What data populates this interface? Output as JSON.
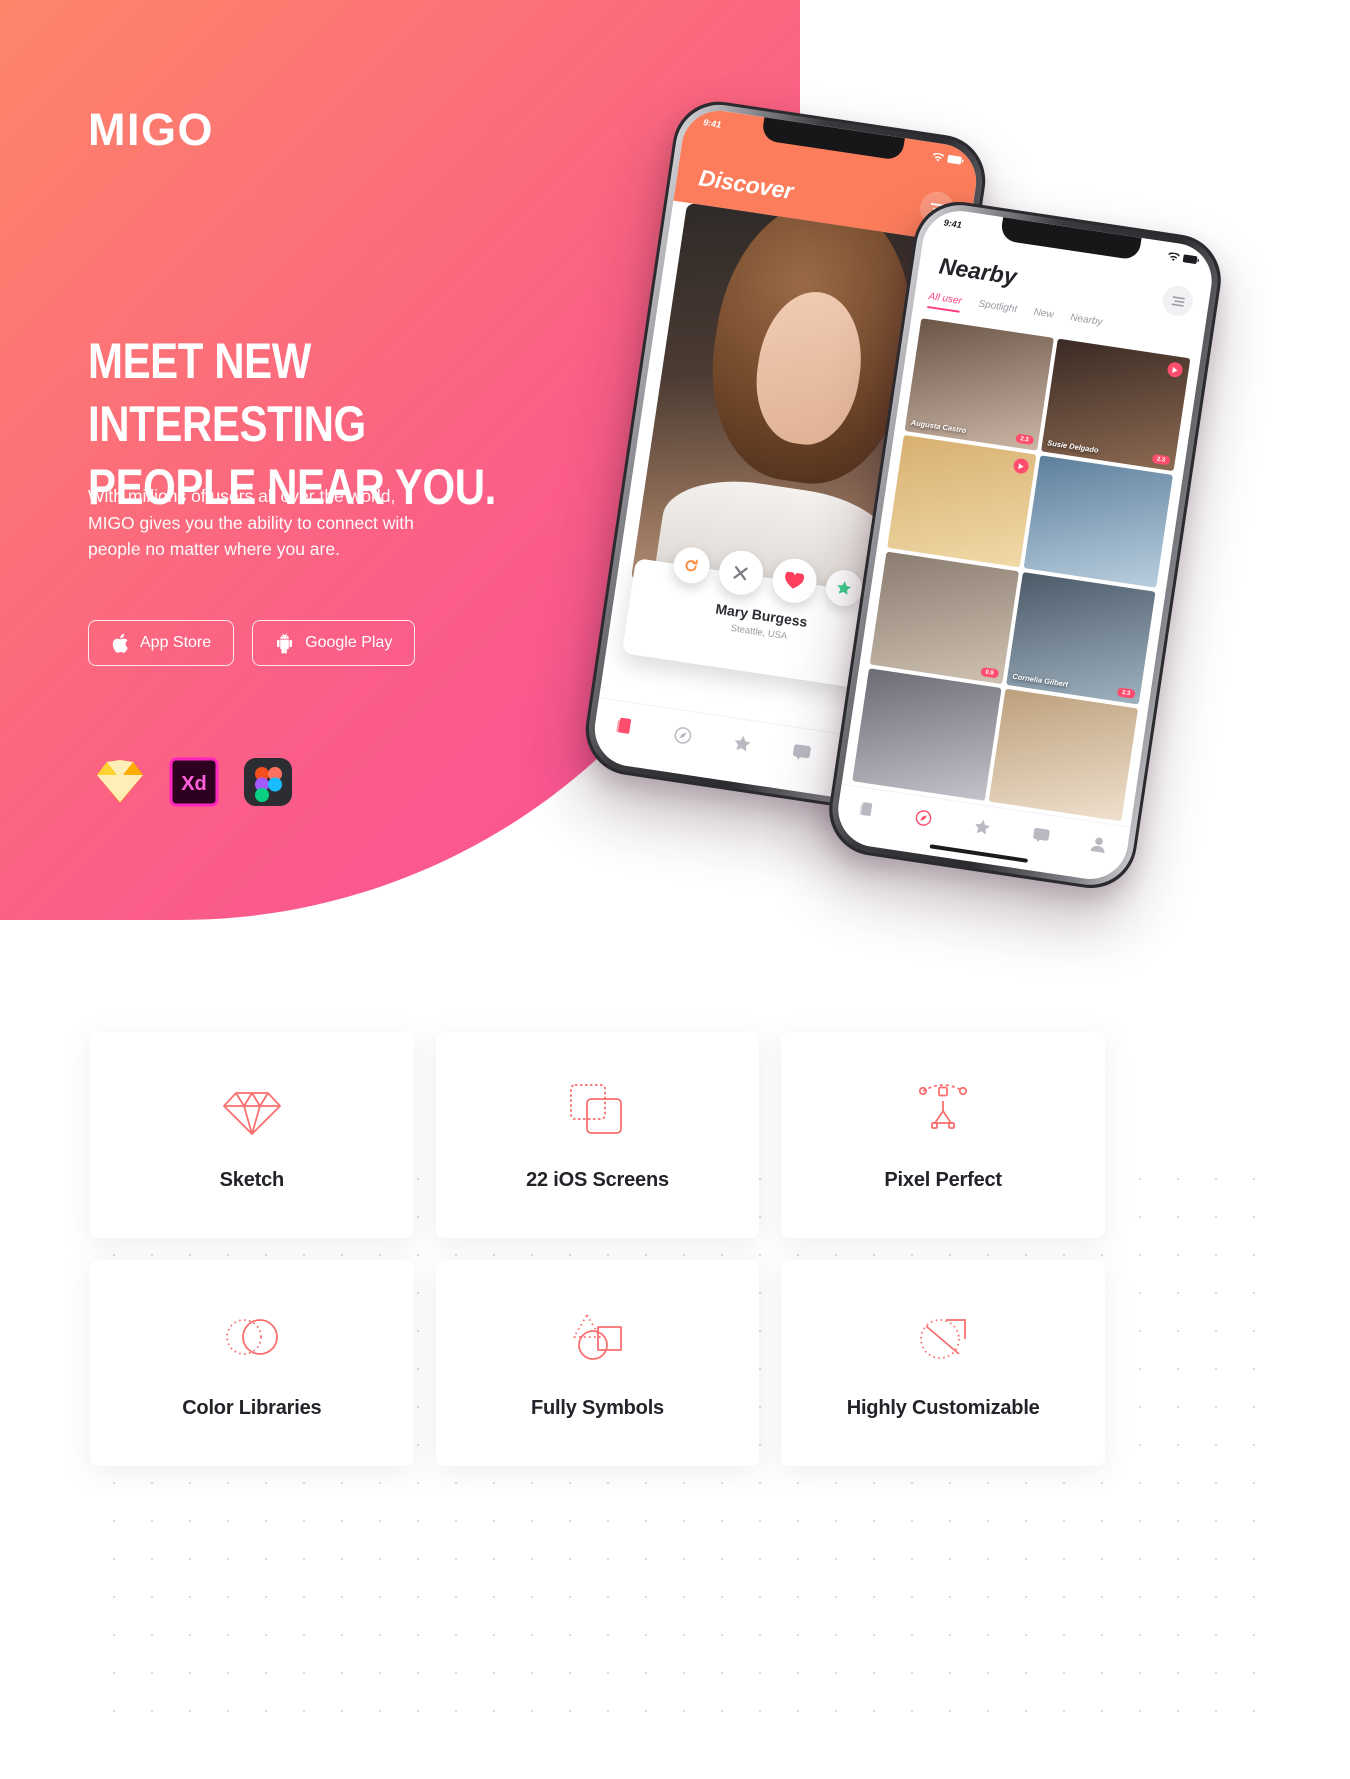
{
  "brand": {
    "name": "MIGO",
    "accent": "#ff3f7d",
    "gradient_from": "#ff9a64",
    "gradient_to": "#f94f9b"
  },
  "hero": {
    "headline_line1": "MEET NEW INTERESTING",
    "headline_line2": "PEOPLE NEAR YOU.",
    "subcopy_line1": "With millions of users all over the world,",
    "subcopy_line2": "MIGO gives you the ability to connect with",
    "subcopy_line3": "people no matter where you are.",
    "buttons": [
      {
        "label": "App Store",
        "icon": "apple-icon"
      },
      {
        "label": "Google Play",
        "icon": "android-icon"
      }
    ],
    "tools": [
      {
        "name": "sketch-icon",
        "label": "Sketch"
      },
      {
        "name": "adobe-xd-icon",
        "label": "Xd"
      },
      {
        "name": "figma-icon",
        "label": "Figma"
      }
    ]
  },
  "phone_discover": {
    "status_time": "9:41",
    "title": "Discover",
    "menu_icon": "hamburger-icon",
    "profile_name": "Mary Burgess",
    "profile_location": "Steattle, USA",
    "actions": [
      "refresh-icon",
      "close-icon",
      "heart-icon",
      "star-icon"
    ],
    "tabbar": [
      "cards-icon",
      "compass-icon",
      "star-icon",
      "chat-icon",
      "profile-icon"
    ]
  },
  "phone_nearby": {
    "status_time": "9:41",
    "title": "Nearby",
    "menu_icon": "hamburger-icon",
    "tabs": [
      {
        "label": "All user",
        "active": true
      },
      {
        "label": "Spotlight",
        "active": false
      },
      {
        "label": "New",
        "active": false
      },
      {
        "label": "Nearby",
        "active": false
      }
    ],
    "people": [
      {
        "name": "Augusta Castro",
        "badge": "2.3",
        "play": false
      },
      {
        "name": "Susie Delgado",
        "badge": "2.3",
        "play": true
      },
      {
        "name": "",
        "badge": "",
        "play": true
      },
      {
        "name": "",
        "badge": "",
        "play": false
      },
      {
        "name": "",
        "badge": "0.9",
        "play": false
      },
      {
        "name": "Cornelia Gilbert",
        "badge": "2.3",
        "play": false
      },
      {
        "name": "",
        "badge": "",
        "play": false
      },
      {
        "name": "",
        "badge": "",
        "play": false
      }
    ],
    "tabbar": [
      "cards-icon",
      "compass-icon",
      "star-icon",
      "chat-icon",
      "profile-icon"
    ]
  },
  "features": {
    "cards": [
      {
        "label": "Sketch",
        "icon": "diamond-icon"
      },
      {
        "label": "22 iOS Screens",
        "icon": "layers-icon"
      },
      {
        "label": "Pixel Perfect",
        "icon": "pen-tool-icon"
      },
      {
        "label": "Color Libraries",
        "icon": "two-circles-icon"
      },
      {
        "label": "Fully Symbols",
        "icon": "shapes-icon"
      },
      {
        "label": "Highly Customizable",
        "icon": "circle-square-icon"
      }
    ]
  }
}
